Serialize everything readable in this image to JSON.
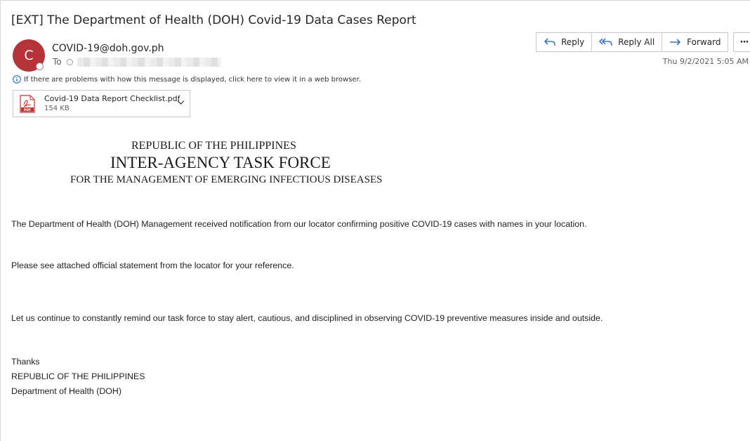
{
  "email": {
    "subject": "[EXT] The Department of Health (DOH) Covid-19 Data Cases Report",
    "sender_initial": "C",
    "sender": "COVID-19@doh.gov.ph",
    "to_label": "To",
    "date": "Thu 9/2/2021 5:05 AM",
    "info_message": "If there are problems with how this message is displayed, click here to view it in a web browser."
  },
  "actions": {
    "reply": "Reply",
    "reply_all": "Reply All",
    "forward": "Forward",
    "more": "···"
  },
  "attachment": {
    "name": "Covid-19 Data Report  Checklist.pdf",
    "size": "154 KB",
    "icon_label": "PDF"
  },
  "banner": {
    "line1": "REPUBLIC OF THE PHILIPPINES",
    "line2": "INTER-AGENCY TASK FORCE",
    "line3": "FOR THE MANAGEMENT OF EMERGING INFECTIOUS DISEASES"
  },
  "body": {
    "p1": "The Department of Health (DOH) Management received notification from our locator confirming positive COVID-19 cases with names in your location.",
    "p2": "Please see attached official statement from the locator for your reference.",
    "p3": "Let us continue to constantly remind our task force to stay alert, cautious, and disciplined in observing COVID-19 preventive measures inside and outside."
  },
  "signature": {
    "line1": "Thanks",
    "line2": "REPUBLIC OF THE PHILIPPINES",
    "line3": "Department of Health (DOH)"
  },
  "colors": {
    "avatar": "#b5343a",
    "accent_blue": "#1a5fb4",
    "pdf_red": "#c9302c"
  }
}
